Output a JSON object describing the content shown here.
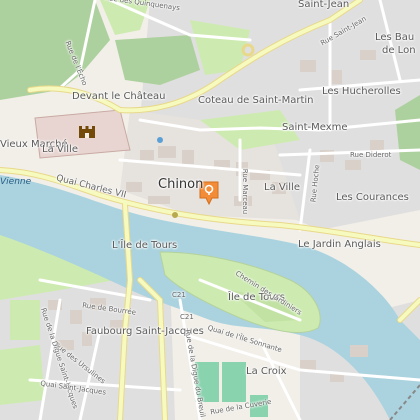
{
  "map": {
    "city_label": "Chinon",
    "places": {
      "devant_le_chateau": "Devant le Château",
      "coteau_de_saint_martin": "Coteau de Saint-Martin",
      "saint_mexme": "Saint-Mexme",
      "les_hucherolles": "Les Hucherolles",
      "vieux_marche": "Vieux Marché",
      "la_ville_west": "La Ville",
      "la_ville_east": "La Ville",
      "les_courances": "Les Courances",
      "le_jardin_anglais": "Le Jardin Anglais",
      "lile_de_tours_west": "L'Île de Tours",
      "ile_de_tours_east": "Île de Tours",
      "faubourg_saint_jacques": "Faubourg Saint-Jacques",
      "la_croix": "La Croix",
      "saint_jean": "Saint-Jean",
      "les_baux": "Les Bau",
      "de_lon": "de Lon"
    },
    "streets": {
      "quinquenays": "Rue des Quinquenays",
      "echo": "Rue de l'Écho",
      "diderot": "Rue Diderot",
      "marceau": "Rue Marceau",
      "hoche": "Rue Hoche",
      "saint_jean": "Rue Saint-Jean",
      "quai_charles_vii": "Quai Charles VII",
      "chemin_jardiniers": "Chemin des Jardiniers",
      "quai_ile_sonnante": "Quai de l'Île Sonnante",
      "bourree": "Rue de Bourrée",
      "ursulines": "Rue des Ursulines",
      "digue_saint_jacques": "Rue de la Digue Saint-Jacques",
      "quai_saint_jacques": "Quai Saint-Jacques",
      "digue_du_breuil": "Rue de la Digue du Breuil",
      "cuverie": "Rue de la Cuverie",
      "c21_north": "C21",
      "c21_south": "C21"
    },
    "river_name": "Vienne",
    "icons": {
      "marker": "location-pin-icon",
      "castle": "castle-icon"
    },
    "colors": {
      "water": "#aad3df",
      "forest": "#add19e",
      "grass": "#cdebb0",
      "residential": "#e0dfdf",
      "building": "#d9d0c9",
      "major_road": "#f7fabf",
      "marker": "#f28c38"
    }
  }
}
